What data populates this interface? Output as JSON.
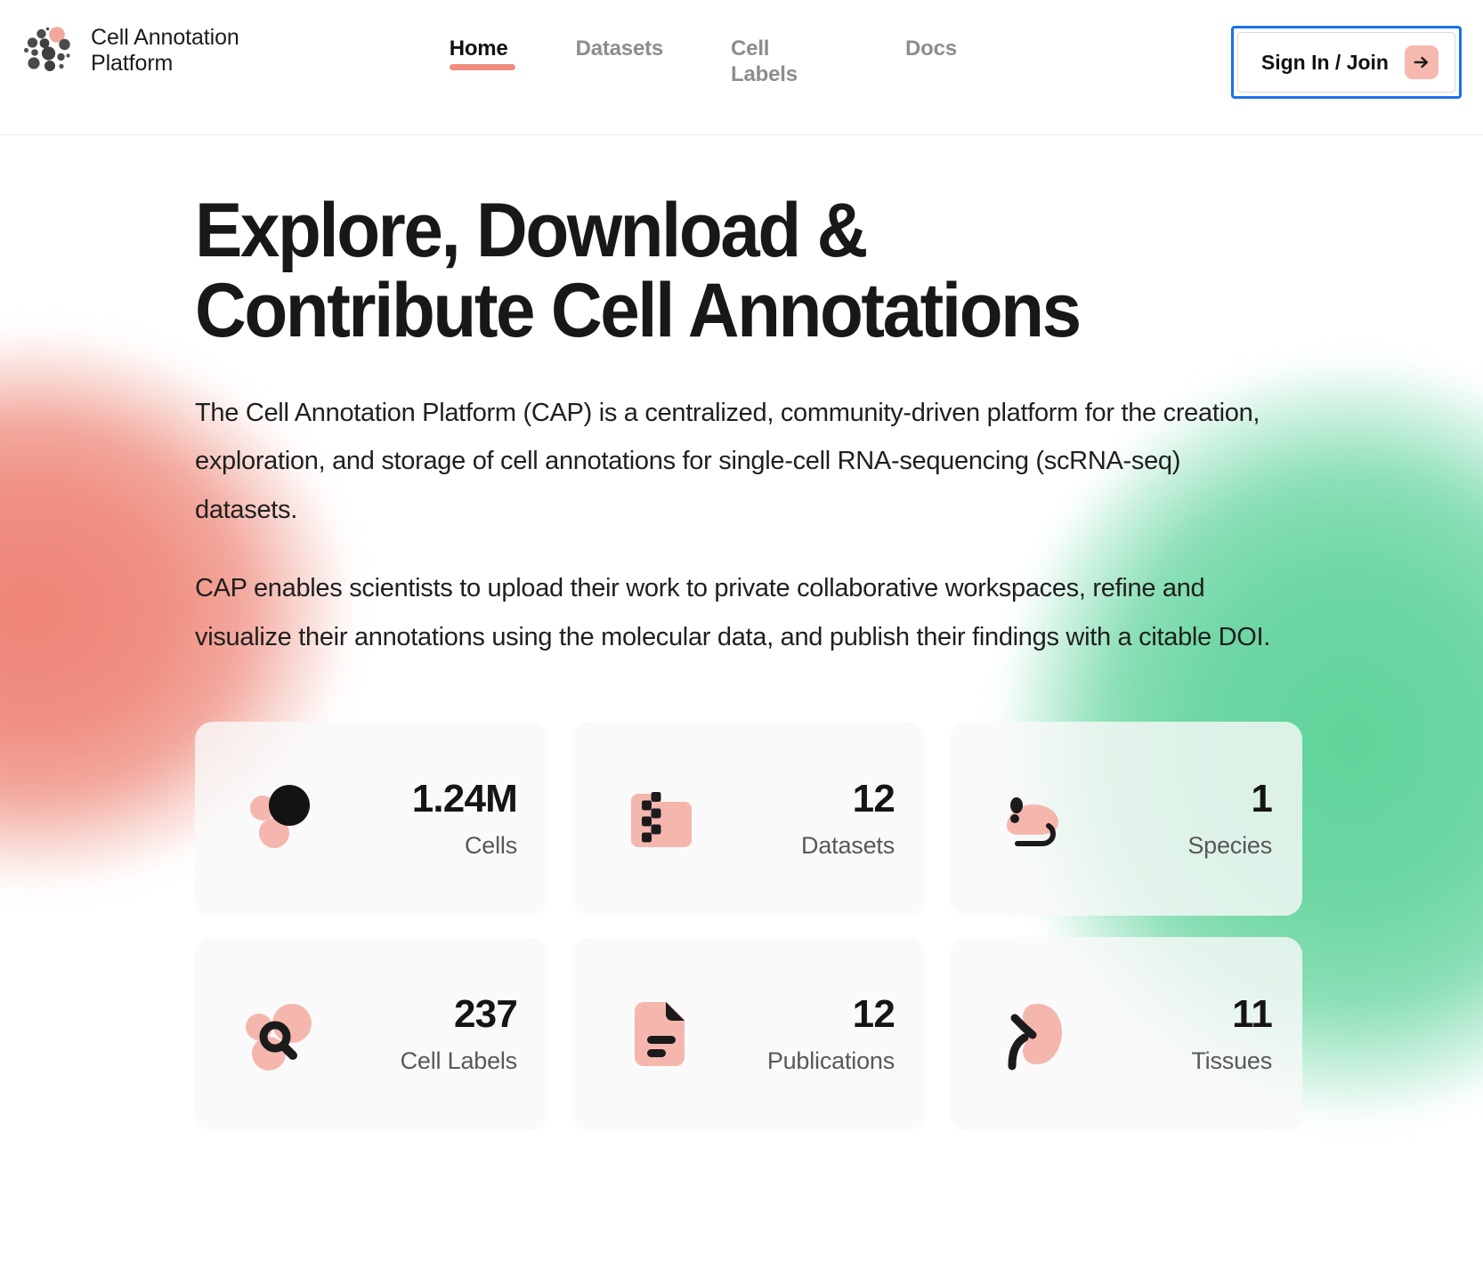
{
  "brand": {
    "name": "Cell Annotation\nPlatform",
    "logo_icon": "cell-cluster-logo"
  },
  "nav": {
    "items": [
      {
        "label": "Home",
        "active": true
      },
      {
        "label": "Datasets",
        "active": false
      },
      {
        "label": "Cell\nLabels",
        "active": false
      },
      {
        "label": "Docs",
        "active": false
      }
    ]
  },
  "auth": {
    "signin_label": "Sign In / Join",
    "arrow_icon": "arrow-right-icon"
  },
  "hero": {
    "title": "Explore, Download &\nContribute Cell Annotations",
    "paragraph_1": "The Cell Annotation Platform (CAP) is a centralized, community-driven platform for the creation, exploration, and storage of cell annotations for single-cell RNA-sequencing (scRNA-seq) datasets.",
    "paragraph_2": "CAP enables scientists to upload their work to private collaborative workspaces, refine and visualize their annotations using the molecular data, and publish their findings with a citable DOI."
  },
  "stats": [
    {
      "value": "1.24M",
      "label": "Cells",
      "icon": "cells-dots-icon"
    },
    {
      "value": "12",
      "label": "Datasets",
      "icon": "dataset-folder-icon"
    },
    {
      "value": "1",
      "label": "Species",
      "icon": "mouse-icon"
    },
    {
      "value": "237",
      "label": "Cell Labels",
      "icon": "cell-labels-magnifier-icon"
    },
    {
      "value": "12",
      "label": "Publications",
      "icon": "publication-document-icon"
    },
    {
      "value": "11",
      "label": "Tissues",
      "icon": "kidney-tissue-icon"
    }
  ],
  "colors": {
    "accent_salmon": "#ef8e80",
    "icon_pink": "#f5b7ad",
    "icon_dark": "#1b1b1b",
    "blob_pink": "#ef8377",
    "blob_green": "#5fd49b",
    "focus_blue": "#1a73e8"
  }
}
